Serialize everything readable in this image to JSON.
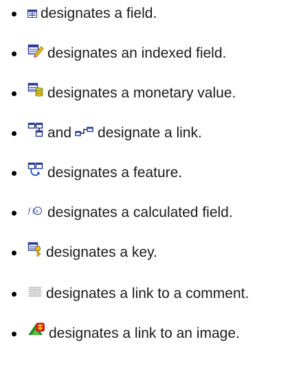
{
  "legend": {
    "items": [
      {
        "icon": "field-icon",
        "text": "designates a field."
      },
      {
        "icon": "indexed-field-icon",
        "text": "designates an indexed field."
      },
      {
        "icon": "monetary-value-icon",
        "text": "designates a monetary value."
      },
      {
        "icon": "link-icon",
        "and_text": "and",
        "icon2": "link-alt-icon",
        "text": "designate a link."
      },
      {
        "icon": "feature-icon",
        "text": "designates a feature."
      },
      {
        "icon": "calculated-field-icon",
        "text": "designates a calculated field."
      },
      {
        "icon": "key-icon",
        "text": "designates a key."
      },
      {
        "icon": "comment-link-icon",
        "text": "designates a link to a comment."
      },
      {
        "icon": "image-link-icon",
        "text": "designates a link to an image."
      }
    ]
  },
  "colors": {
    "text": "#1a1a1a",
    "icon_blue": "#2a3d9c",
    "icon_yellow": "#f0c020",
    "icon_green": "#2a8a2a",
    "icon_red": "#d02020"
  }
}
